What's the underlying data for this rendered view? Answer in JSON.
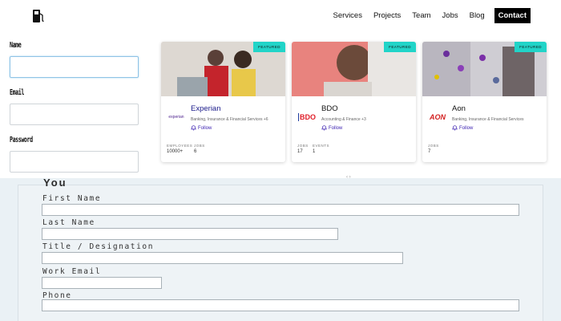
{
  "nav": {
    "items": [
      "Services",
      "Projects",
      "Team",
      "Jobs",
      "Blog"
    ],
    "contact": "Contact",
    "logo_icon": "fuel-pump-icon"
  },
  "sideform": {
    "labels": [
      "Name",
      "Email",
      "Password"
    ]
  },
  "cards": [
    {
      "badge": "FEATURED",
      "name": "Experian",
      "logo_text": "experian",
      "category": "Banking, Insurance & Financial Services +6",
      "follow": "Follow",
      "stats": [
        {
          "key": "EMPLOYEES",
          "value": "10000+"
        },
        {
          "key": "JOBS",
          "value": "6"
        }
      ]
    },
    {
      "badge": "FEATURED",
      "name": "BDO",
      "logo_text": "BDO",
      "category": "Accounting & Finance +3",
      "follow": "Follow",
      "stats": [
        {
          "key": "JOBS",
          "value": "17"
        },
        {
          "key": "EVENTS",
          "value": "1"
        }
      ]
    },
    {
      "badge": "FEATURED",
      "name": "Aon",
      "logo_text": "AON",
      "category": "Banking, Insurance & Financial Services",
      "follow": "Follow",
      "stats": [
        {
          "key": "JOBS",
          "value": "7"
        }
      ]
    }
  ],
  "pager": "‹ ›",
  "you_form": {
    "title": "You",
    "labels": [
      "First Name",
      "Last Name",
      "Title / Designation",
      "Work Email",
      "Phone"
    ]
  },
  "colors": {
    "badge": "#21d4c8",
    "follow": "#3a1fb0",
    "nav_contact_bg": "#000000"
  }
}
